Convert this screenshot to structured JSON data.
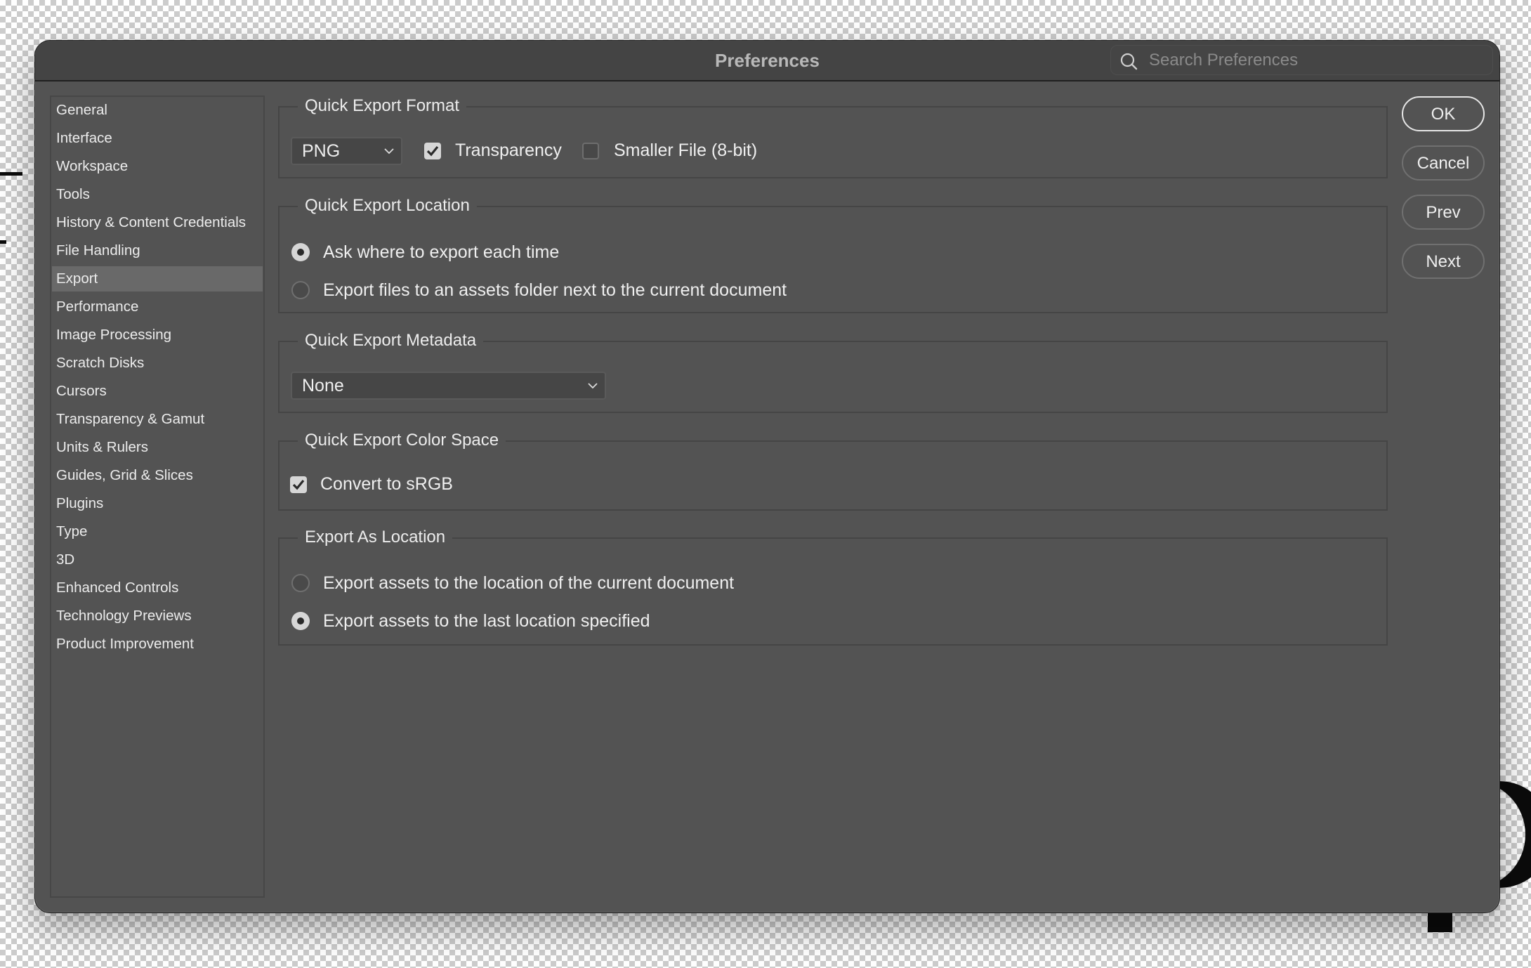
{
  "dialog": {
    "title": "Preferences",
    "search_placeholder": "Search Preferences"
  },
  "sidebar": {
    "active": "Export",
    "items": [
      {
        "label": "General"
      },
      {
        "label": "Interface"
      },
      {
        "label": "Workspace"
      },
      {
        "label": "Tools"
      },
      {
        "label": "History & Content Credentials"
      },
      {
        "label": "File Handling"
      },
      {
        "label": "Export"
      },
      {
        "label": "Performance"
      },
      {
        "label": "Image Processing"
      },
      {
        "label": "Scratch Disks"
      },
      {
        "label": "Cursors"
      },
      {
        "label": "Transparency & Gamut"
      },
      {
        "label": "Units & Rulers"
      },
      {
        "label": "Guides, Grid & Slices"
      },
      {
        "label": "Plugins"
      },
      {
        "label": "Type"
      },
      {
        "label": "3D"
      },
      {
        "label": "Enhanced Controls"
      },
      {
        "label": "Technology Previews"
      },
      {
        "label": "Product Improvement"
      }
    ]
  },
  "sections": {
    "format": {
      "title": "Quick Export Format",
      "format_value": "PNG",
      "transparency": {
        "label": "Transparency",
        "checked": true
      },
      "smaller_file": {
        "label": "Smaller File (8-bit)",
        "checked": false
      }
    },
    "location": {
      "title": "Quick Export Location",
      "options": [
        {
          "label": "Ask where to export each time",
          "selected": true
        },
        {
          "label": "Export files to an assets folder next to the current document",
          "selected": false
        }
      ]
    },
    "metadata": {
      "title": "Quick Export Metadata",
      "value": "None"
    },
    "color_space": {
      "title": "Quick Export Color Space",
      "convert_srgb": {
        "label": "Convert to sRGB",
        "checked": true
      }
    },
    "export_as_location": {
      "title": "Export As Location",
      "options": [
        {
          "label": "Export assets to the location of the current document",
          "selected": false
        },
        {
          "label": "Export assets to the last location specified",
          "selected": true
        }
      ]
    }
  },
  "buttons": {
    "ok": "OK",
    "cancel": "Cancel",
    "prev": "Prev",
    "next": "Next"
  },
  "colors": {
    "dialog_bg": "#535353",
    "titlebar_bg": "#444444",
    "selected_item_bg": "#696969",
    "text": "#efefef"
  }
}
